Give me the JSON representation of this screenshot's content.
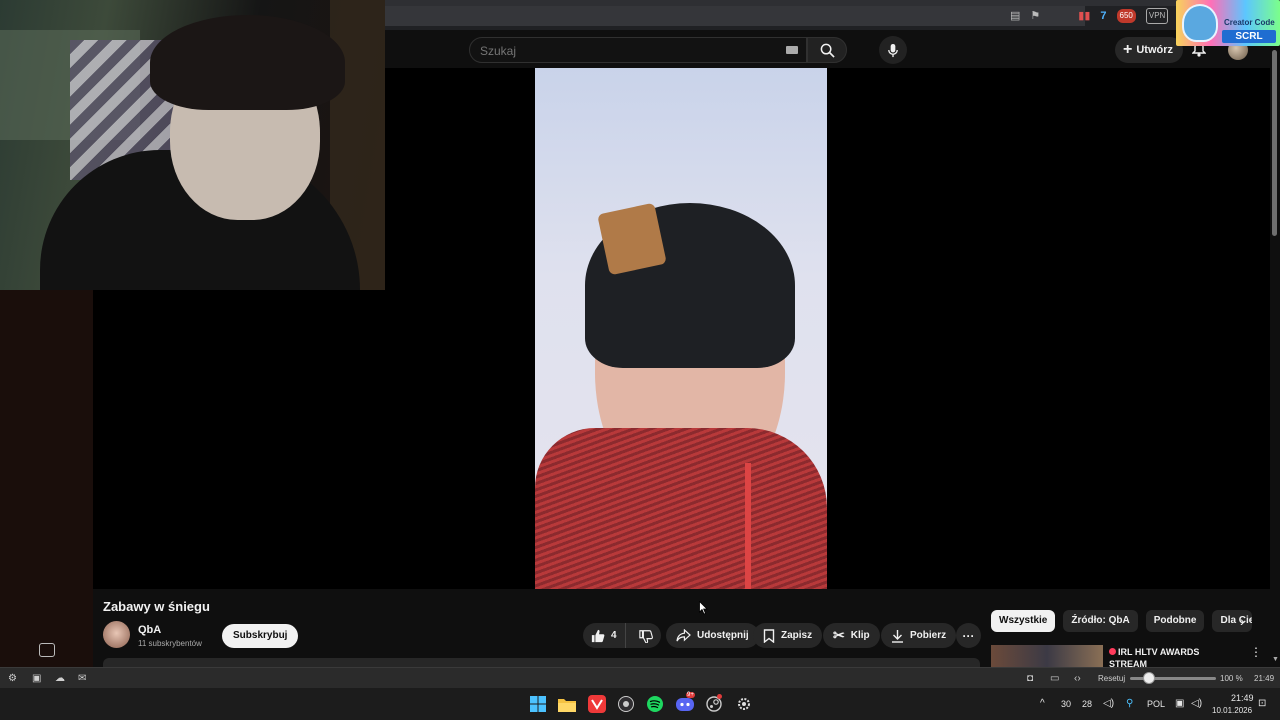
{
  "browser": {
    "extension_badges": {
      "count": "650",
      "vpn": "VPN"
    }
  },
  "creator_code": {
    "label": "Creator Code",
    "code": "SCRL"
  },
  "header": {
    "search_placeholder": "Szukaj",
    "create_label": "Utwórz"
  },
  "video": {
    "title": "Zabawy w śniegu",
    "channel": "QbA",
    "subscribers": "11 subskrybentów",
    "subscribe_label": "Subskrybuj",
    "likes": "4",
    "actions": {
      "share": "Udostępnij",
      "save": "Zapisz",
      "clip": "Klip",
      "download": "Pobierz",
      "more": "···"
    }
  },
  "recommendations": {
    "chips": [
      "Wszystkie",
      "Źródło: QbA",
      "Podobne",
      "Dla Ciebie"
    ],
    "first_title": "IRL HLTV AWARDS STREAM"
  },
  "statusbar": {
    "reset_label": "Resetuj",
    "zoom": "100 %",
    "clock": "21:49"
  },
  "taskbar": {
    "tray_num1": "30",
    "tray_num2": "28",
    "language": "POL",
    "time": "21:49",
    "date": "10.01.2026",
    "discord_badge": "9+"
  },
  "colors": {
    "yt_bg": "#0f0f0f",
    "pill_bg": "#272727",
    "accent_red": "#ff0033"
  }
}
